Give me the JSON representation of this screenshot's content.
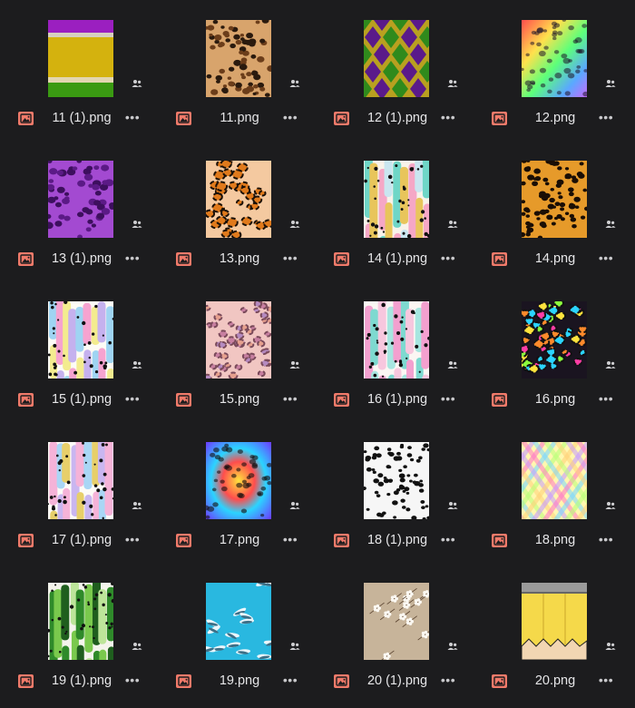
{
  "files": [
    {
      "name": "11 (1).png",
      "thumb": "gold-glitter-stripes",
      "shared": true
    },
    {
      "name": "11.png",
      "thumb": "leopard-tan",
      "shared": true
    },
    {
      "name": "12 (1).png",
      "thumb": "mardi-gras-harlequin",
      "shared": true
    },
    {
      "name": "12.png",
      "thumb": "rainbow-leopard",
      "shared": true
    },
    {
      "name": "13 (1).png",
      "thumb": "purple-glitter-leopard",
      "shared": true
    },
    {
      "name": "13.png",
      "thumb": "orange-leopard",
      "shared": true
    },
    {
      "name": "14 (1).png",
      "thumb": "brush-strokes-teal-gold",
      "shared": true
    },
    {
      "name": "14.png",
      "thumb": "cheetah-orange",
      "shared": true
    },
    {
      "name": "15 (1).png",
      "thumb": "pastel-brush-strokes",
      "shared": true
    },
    {
      "name": "15.png",
      "thumb": "pastel-leopard",
      "shared": true
    },
    {
      "name": "16 (1).png",
      "thumb": "pink-teal-brush-strokes",
      "shared": true
    },
    {
      "name": "16.png",
      "thumb": "neon-leopard",
      "shared": true
    },
    {
      "name": "17 (1).png",
      "thumb": "pastel-glitter-strokes",
      "shared": true
    },
    {
      "name": "17.png",
      "thumb": "tie-dye-leopard",
      "shared": true
    },
    {
      "name": "18 (1).png",
      "thumb": "dalmatian-spots",
      "shared": true
    },
    {
      "name": "18.png",
      "thumb": "rainbow-plaid",
      "shared": true
    },
    {
      "name": "19 (1).png",
      "thumb": "green-brush-strokes",
      "shared": true
    },
    {
      "name": "19.png",
      "thumb": "shark-pattern",
      "shared": true
    },
    {
      "name": "20 (1).png",
      "thumb": "floral-beige",
      "shared": true
    },
    {
      "name": "20.png",
      "thumb": "yellow-pencil",
      "shared": true
    }
  ],
  "icons": {
    "file_type": "image-file-icon",
    "shared": "shared-people-icon",
    "more": "more-options-icon"
  },
  "more_glyph": "•••",
  "colors": {
    "background": "#1c1c1e",
    "file_icon": "#f07a6a",
    "text": "#e6e6e8"
  }
}
